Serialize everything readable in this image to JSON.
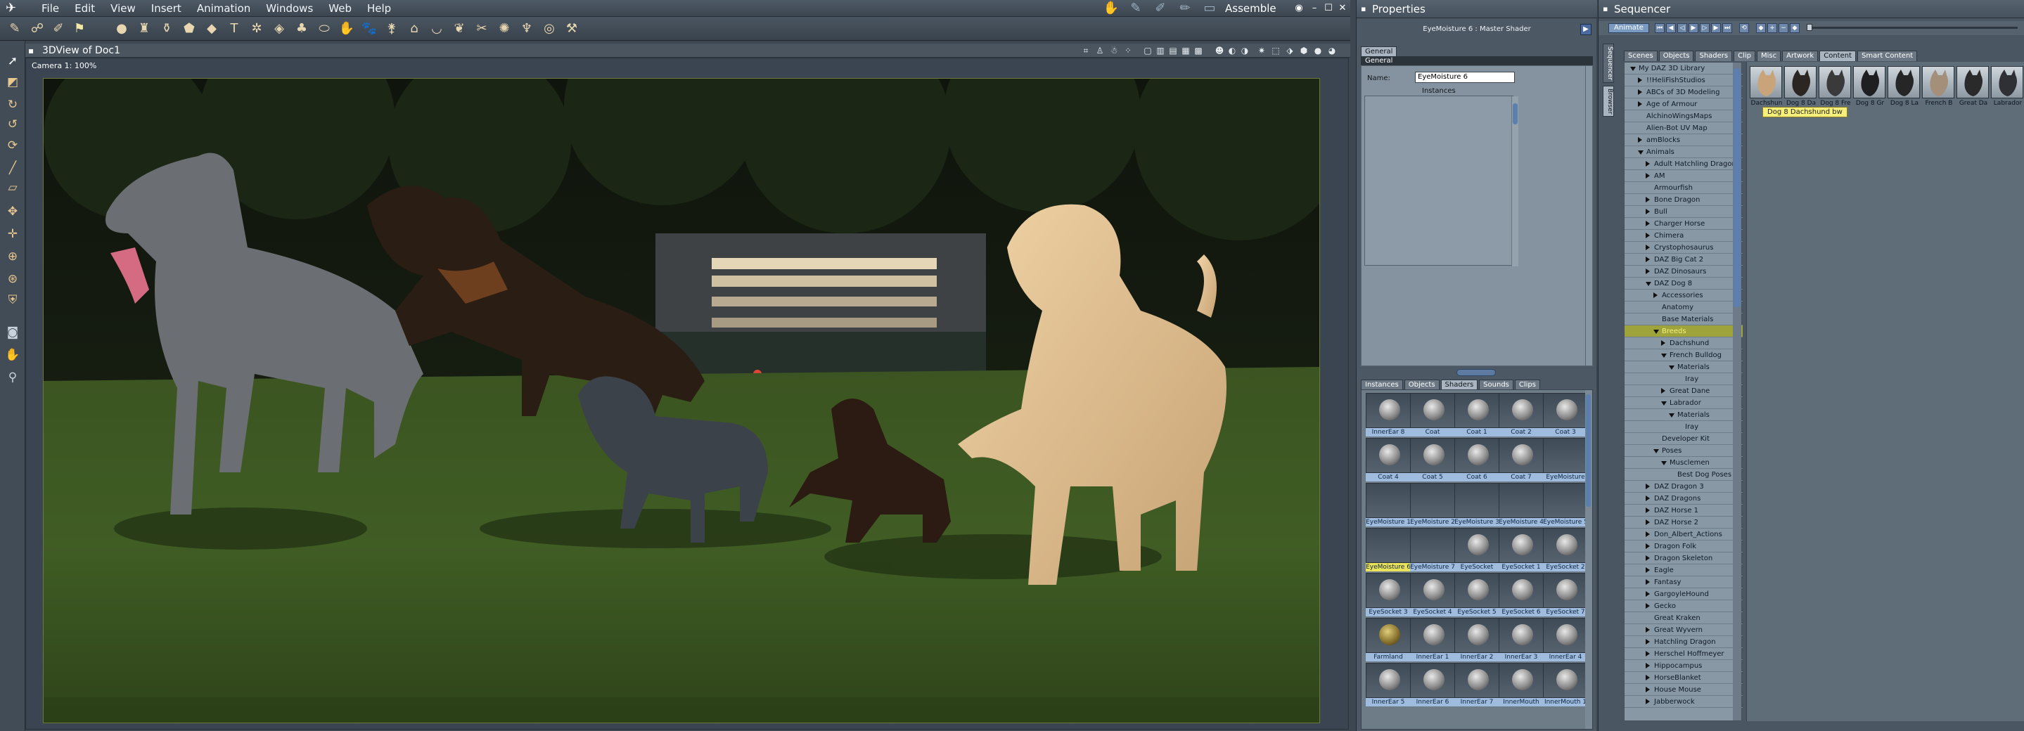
{
  "menubar": {
    "items": [
      "File",
      "Edit",
      "View",
      "Insert",
      "Animation",
      "Windows",
      "Web",
      "Help"
    ],
    "room": "Assemble"
  },
  "viewport": {
    "title": "3DView of Doc1",
    "camera": "Camera 1: 100%"
  },
  "properties": {
    "title": "Properties",
    "shader_title": "EyeMoisture 6 : Master Shader",
    "tabs": [
      "General"
    ],
    "section": "General",
    "name_label": "Name:",
    "name_value": "EyeMoisture 6",
    "instances_label": "Instances",
    "browser_tabs": [
      "Instances",
      "Objects",
      "Shaders",
      "Sounds",
      "Clips"
    ],
    "browser_selected_tab": "Shaders",
    "shaders": [
      {
        "label": "InnerEar 8",
        "thumb": true
      },
      {
        "label": "Coat",
        "thumb": true
      },
      {
        "label": "Coat 1",
        "thumb": true
      },
      {
        "label": "Coat 2",
        "thumb": true
      },
      {
        "label": "Coat 3",
        "thumb": true
      },
      {
        "label": "Coat 4",
        "thumb": true
      },
      {
        "label": "Coat 5",
        "thumb": true
      },
      {
        "label": "Coat 6",
        "thumb": true
      },
      {
        "label": "Coat 7",
        "thumb": true
      },
      {
        "label": "EyeMoisture",
        "thumb": false
      },
      {
        "label": "EyeMoisture 1",
        "thumb": false
      },
      {
        "label": "EyeMoisture 2",
        "thumb": false
      },
      {
        "label": "EyeMoisture 3",
        "thumb": false
      },
      {
        "label": "EyeMoisture 4",
        "thumb": false
      },
      {
        "label": "EyeMoisture 5",
        "thumb": false
      },
      {
        "label": "EyeMoisture 6",
        "thumb": false,
        "selected": true
      },
      {
        "label": "EyeMoisture 7",
        "thumb": false
      },
      {
        "label": "EyeSocket",
        "thumb": true
      },
      {
        "label": "EyeSocket 1",
        "thumb": true
      },
      {
        "label": "EyeSocket 2",
        "thumb": true
      },
      {
        "label": "EyeSocket 3",
        "thumb": true
      },
      {
        "label": "EyeSocket 4",
        "thumb": true
      },
      {
        "label": "EyeSocket 5",
        "thumb": true
      },
      {
        "label": "EyeSocket 6",
        "thumb": true
      },
      {
        "label": "EyeSocket 7",
        "thumb": true
      },
      {
        "label": "Farmland",
        "thumb": true,
        "gold": true
      },
      {
        "label": "InnerEar 1",
        "thumb": true
      },
      {
        "label": "InnerEar 2",
        "thumb": true
      },
      {
        "label": "InnerEar 3",
        "thumb": true
      },
      {
        "label": "InnerEar 4",
        "thumb": true
      },
      {
        "label": "InnerEar 5",
        "thumb": true
      },
      {
        "label": "InnerEar 6",
        "thumb": true
      },
      {
        "label": "InnerEar 7",
        "thumb": true
      },
      {
        "label": "InnerMouth",
        "thumb": true
      },
      {
        "label": "InnerMouth 1",
        "thumb": true
      }
    ]
  },
  "sequencer": {
    "title": "Sequencer",
    "animate_label": "Animate",
    "side_tabs": [
      "Sequencer",
      "Browser"
    ],
    "tabs": [
      "Scenes",
      "Objects",
      "Shaders",
      "Clip",
      "Misc",
      "Artwork",
      "Content",
      "Smart Content"
    ],
    "selected_tab": "Content",
    "tree": [
      {
        "label": "My DAZ 3D Library",
        "level": 0,
        "state": "open"
      },
      {
        "label": "!!HeliFishStudios",
        "level": 1,
        "state": "closed"
      },
      {
        "label": "ABCs of 3D Modeling",
        "level": 1,
        "state": "closed"
      },
      {
        "label": "Age of Armour",
        "level": 1,
        "state": "closed"
      },
      {
        "label": "AlchinoWingsMaps",
        "level": 1,
        "state": "none"
      },
      {
        "label": "Alien-Bot UV Map",
        "level": 1,
        "state": "none"
      },
      {
        "label": "amBlocks",
        "level": 1,
        "state": "closed"
      },
      {
        "label": "Animals",
        "level": 1,
        "state": "open"
      },
      {
        "label": "Adult Hatchling Dragon",
        "level": 2,
        "state": "closed"
      },
      {
        "label": "AM",
        "level": 2,
        "state": "closed"
      },
      {
        "label": "Armourfish",
        "level": 2,
        "state": "none"
      },
      {
        "label": "Bone Dragon",
        "level": 2,
        "state": "closed"
      },
      {
        "label": "Bull",
        "level": 2,
        "state": "closed"
      },
      {
        "label": "Charger Horse",
        "level": 2,
        "state": "closed"
      },
      {
        "label": "Chimera",
        "level": 2,
        "state": "closed"
      },
      {
        "label": "Crystophosaurus",
        "level": 2,
        "state": "closed"
      },
      {
        "label": "DAZ Big Cat 2",
        "level": 2,
        "state": "closed"
      },
      {
        "label": "DAZ Dinosaurs",
        "level": 2,
        "state": "closed"
      },
      {
        "label": "DAZ Dog 8",
        "level": 2,
        "state": "open"
      },
      {
        "label": "Accessories",
        "level": 3,
        "state": "closed"
      },
      {
        "label": "Anatomy",
        "level": 3,
        "state": "none"
      },
      {
        "label": "Base Materials",
        "level": 3,
        "state": "none"
      },
      {
        "label": "Breeds",
        "level": 3,
        "state": "open",
        "highlight": true
      },
      {
        "label": "Dachshund",
        "level": 4,
        "state": "closed"
      },
      {
        "label": "French Bulldog",
        "level": 4,
        "state": "open"
      },
      {
        "label": "Materials",
        "level": 5,
        "state": "open"
      },
      {
        "label": "Iray",
        "level": 6,
        "state": "none"
      },
      {
        "label": "Great Dane",
        "level": 4,
        "state": "closed"
      },
      {
        "label": "Labrador",
        "level": 4,
        "state": "open"
      },
      {
        "label": "Materials",
        "level": 5,
        "state": "open"
      },
      {
        "label": "Iray",
        "level": 6,
        "state": "none"
      },
      {
        "label": "Developer Kit",
        "level": 3,
        "state": "none"
      },
      {
        "label": "Poses",
        "level": 3,
        "state": "open"
      },
      {
        "label": "Musclemen",
        "level": 4,
        "state": "open"
      },
      {
        "label": "Best Dog Poses",
        "level": 5,
        "state": "none"
      },
      {
        "label": "DAZ Dragon 3",
        "level": 2,
        "state": "closed"
      },
      {
        "label": "DAZ Dragons",
        "level": 2,
        "state": "closed"
      },
      {
        "label": "DAZ Horse 1",
        "level": 2,
        "state": "closed"
      },
      {
        "label": "DAZ Horse 2",
        "level": 2,
        "state": "closed"
      },
      {
        "label": "Don_Albert_Actions",
        "level": 2,
        "state": "closed"
      },
      {
        "label": "Dragon Folk",
        "level": 2,
        "state": "closed"
      },
      {
        "label": "Dragon Skeleton",
        "level": 2,
        "state": "closed"
      },
      {
        "label": "Eagle",
        "level": 2,
        "state": "closed"
      },
      {
        "label": "Fantasy",
        "level": 2,
        "state": "closed"
      },
      {
        "label": "GargoyleHound",
        "level": 2,
        "state": "closed"
      },
      {
        "label": "Gecko",
        "level": 2,
        "state": "closed"
      },
      {
        "label": "Great Kraken",
        "level": 2,
        "state": "none"
      },
      {
        "label": "Great Wyvern",
        "level": 2,
        "state": "closed"
      },
      {
        "label": "Hatchling Dragon",
        "level": 2,
        "state": "closed"
      },
      {
        "label": "Herschel Hoffmeyer",
        "level": 2,
        "state": "closed"
      },
      {
        "label": "Hippocampus",
        "level": 2,
        "state": "closed"
      },
      {
        "label": "HorseBlanket",
        "level": 2,
        "state": "closed"
      },
      {
        "label": "House Mouse",
        "level": 2,
        "state": "closed"
      },
      {
        "label": "Jabberwock",
        "level": 2,
        "state": "closed"
      }
    ],
    "content_items": [
      "Dachshun",
      "Dog 8 Da",
      "Dog 8 Fre",
      "Dog 8 Gr",
      "Dog 8 La",
      "French B",
      "Great Da",
      "Labrador"
    ],
    "tooltip": "Dog 8 Dachshund bw"
  }
}
